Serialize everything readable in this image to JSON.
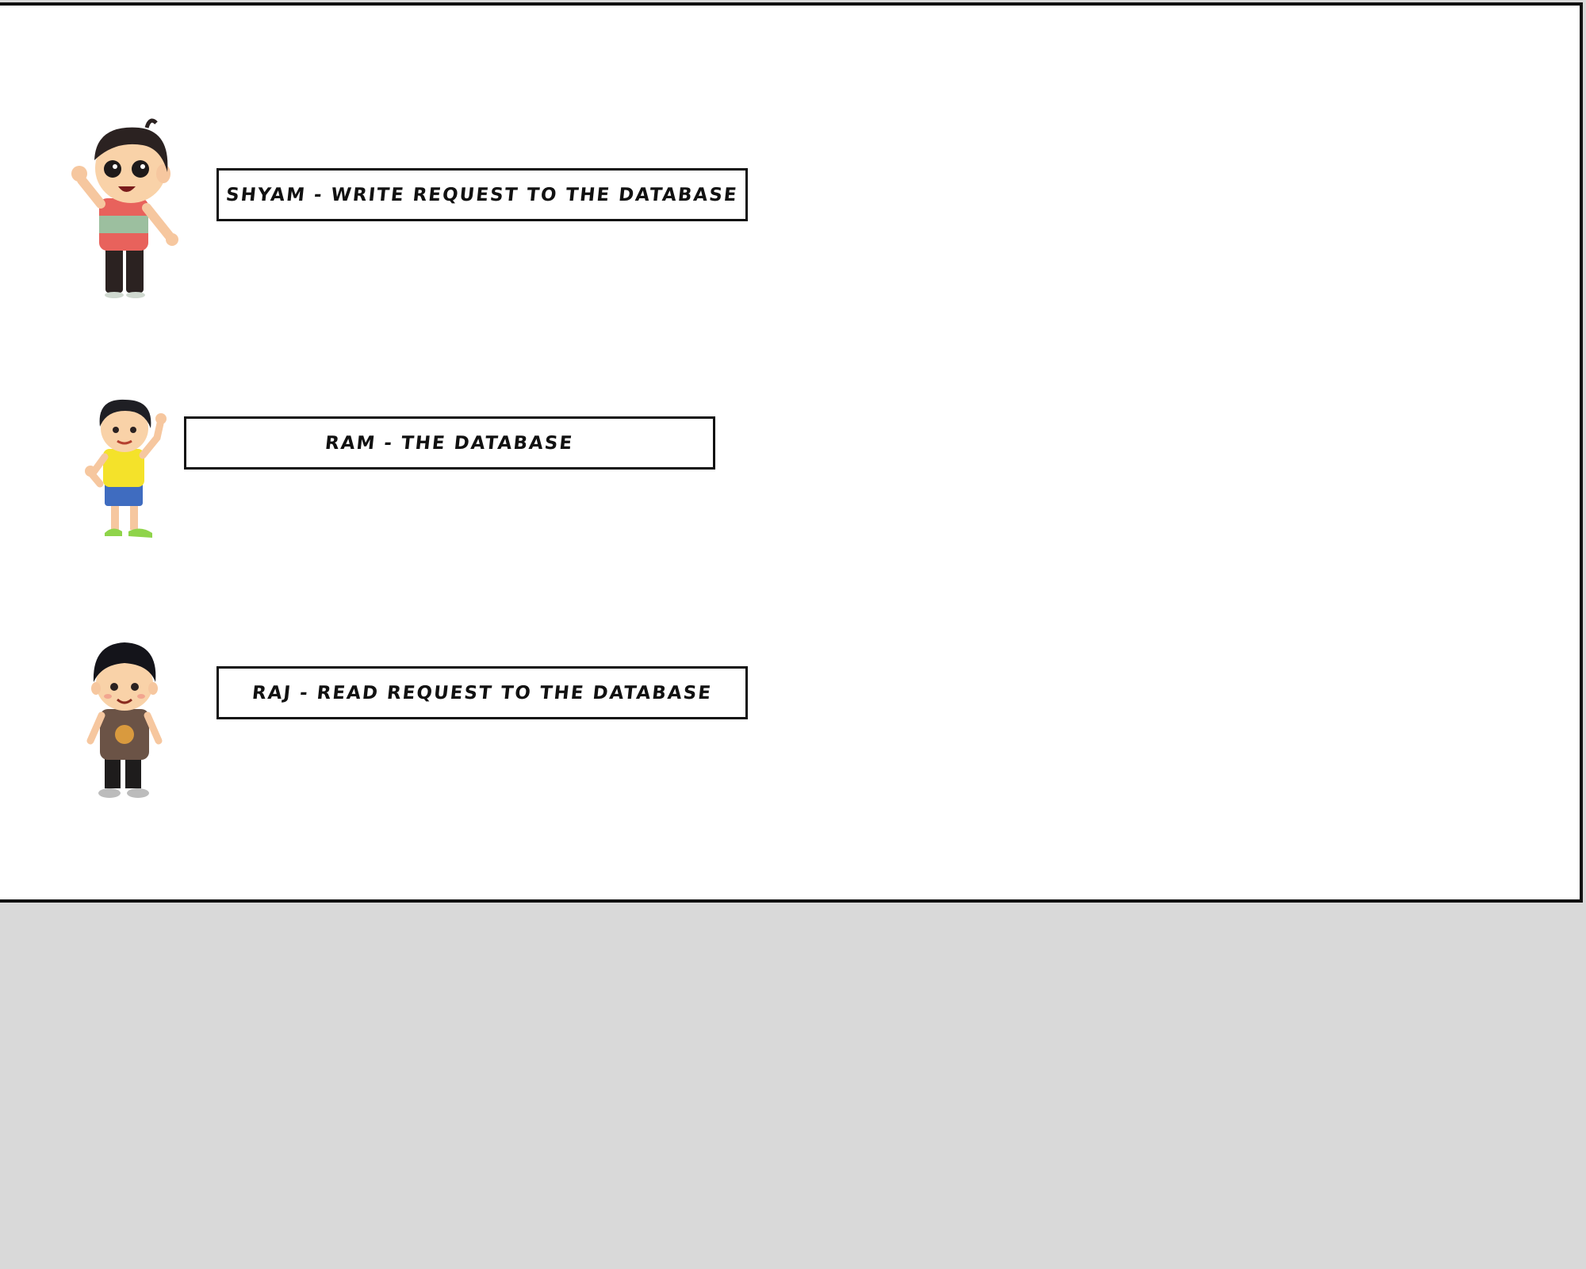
{
  "labels": {
    "shyam": "SHYAM - WRITE REQUEST TO THE DATABASE",
    "ram": "RAM - THE DATABASE",
    "raj": "RAJ - READ REQUEST TO THE DATABASE"
  },
  "colors": {
    "background": "#d9d9d9",
    "canvas": "#ffffff",
    "border": "#111111",
    "shyam_shirt_top": "#e8625c",
    "shyam_shirt_stripe": "#9cbf9f",
    "ram_shirt": "#f4e22a",
    "ram_shorts": "#3f6cc0",
    "raj_shirt": "#6b5346"
  },
  "icons": [
    "boy-waving-icon",
    "boy-yellow-shirt-icon",
    "boy-brown-shirt-icon"
  ]
}
